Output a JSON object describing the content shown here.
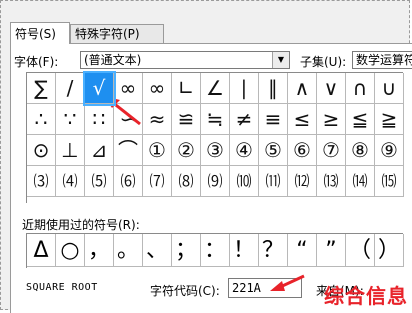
{
  "tabs": [
    {
      "label": "符号(S)"
    },
    {
      "label": "特殊字符(P)"
    }
  ],
  "font": {
    "label": "字体(F):",
    "value": "(普通文本)"
  },
  "subset": {
    "label": "子集(U):",
    "value": "数学运算符"
  },
  "symbols": [
    [
      "∑",
      "/",
      "√",
      "∞",
      "∞",
      "∟",
      "∠",
      "∣",
      "∥",
      "∧",
      "∨",
      "∩",
      "∪"
    ],
    [
      "∴",
      "∵",
      "∷",
      "∽",
      "≈",
      "≌",
      "≒",
      "≠",
      "≡",
      "≤",
      "≥",
      "≦",
      "≧"
    ],
    [
      "⊙",
      "⊥",
      "⊿",
      "⌒",
      "①",
      "②",
      "③",
      "④",
      "⑤",
      "⑥",
      "⑦",
      "⑧",
      "⑨"
    ],
    [
      "⑶",
      "⑷",
      "⑸",
      "⑹",
      "⑺",
      "⑻",
      "⑼",
      "⑽",
      "⑾",
      "⑿",
      "⒀",
      "⒁",
      "⒂"
    ]
  ],
  "selected_symbol": "√",
  "recent": {
    "label": "近期使用过的符号(R):",
    "items": [
      "Δ",
      "○",
      "，",
      "。",
      "、",
      "；",
      "：",
      "！",
      "？",
      "“",
      "”",
      "（",
      "）"
    ]
  },
  "char_name": "SQUARE ROOT",
  "char_code": {
    "label": "字符代码(C):",
    "value": "221A"
  },
  "from": {
    "label": "来自(M):"
  },
  "watermark": "综合信息",
  "colors": {
    "selected": "#1e8ff0",
    "arrow": "#e8232a"
  }
}
